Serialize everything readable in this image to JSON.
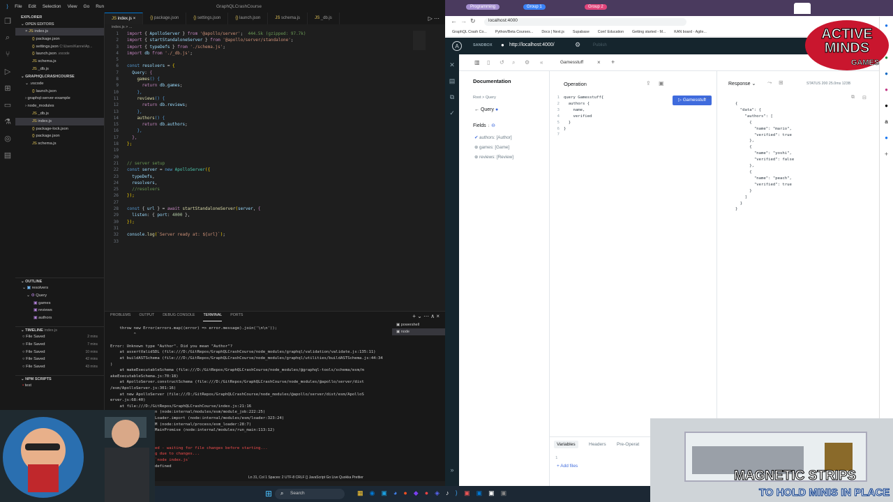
{
  "vscode": {
    "menu": [
      "File",
      "Edit",
      "Selection",
      "View",
      "Go",
      "Run"
    ],
    "title": "GraphQLCrashCourse",
    "explorer_label": "EXPLORER",
    "open_editors_label": "OPEN EDITORS",
    "open_editors": [
      "index.js",
      "package.json",
      "settings.json",
      "launch.json",
      "schema.js",
      "_db.js"
    ],
    "launch_hint": "C:\\Users\\Kanne\\Ap...",
    "launch_vscode": ".vscode",
    "project_label": "GRAPHQLCRASHCOURSE",
    "tree": [
      ".vscode",
      "launch.json",
      "graphql-server-example",
      "node_modules",
      "_db.js",
      "index.js",
      "package-lock.json",
      "package.json",
      "schema.js"
    ],
    "outline_label": "OUTLINE",
    "outline": [
      "resolvers",
      "Query",
      "games",
      "reviews",
      "authors"
    ],
    "timeline_label": "TIMELINE",
    "timeline_file": "index.js",
    "timeline": [
      [
        "File Saved",
        "2 mins"
      ],
      [
        "File Saved",
        "7 mins"
      ],
      [
        "File Saved",
        "10 mins"
      ],
      [
        "File Saved",
        "42 mins"
      ],
      [
        "File Saved",
        "43 mins"
      ]
    ],
    "npm_label": "NPM SCRIPTS",
    "npm_item": "test",
    "tabs": [
      "index.js",
      "package.json",
      "settings.json",
      "launch.json",
      "schema.js",
      "_db.js"
    ],
    "breadcrumb": "index.js > ...",
    "code_lines": [
      "import { ApolloServer } from '@apollo/server';  444.5k (gzipped: 97.7k)",
      "import { startStandaloneServer } from '@apollo/server/standalone';",
      "import { typeDefs } from './schema.js';",
      "import db from './_db.js';",
      "",
      "const resolvers = {",
      "  Query: {",
      "    games() {",
      "      return db.games;",
      "    },",
      "    reviews() {",
      "      return db.reviews;",
      "    },",
      "    authors() {",
      "      return db.authors;",
      "    },",
      "  },",
      "};",
      "",
      "",
      "// server setup",
      "const server = new ApolloServer({",
      "  typeDefs,",
      "  resolvers,",
      "  //resolvers",
      "});",
      "",
      "const { url } = await startStandaloneServer(server, {",
      "  listen: { port: 4000 },",
      "});",
      "",
      "console.log(`Server ready at: ${url}`);",
      ""
    ],
    "panel_tabs": [
      "PROBLEMS",
      "OUTPUT",
      "DEBUG CONSOLE",
      "TERMINAL",
      "PORTS"
    ],
    "terminals": [
      "powershell",
      "node"
    ],
    "terminal_lines": [
      "    throw new Error(errors.map((error) => error.message).join('\\n\\n'));",
      "          ^",
      "",
      "Error: Unknown type \"Author\". Did you mean \"Author\"?",
      "    at assertValidSDL (file:///D:/GitRepos/GraphQLCrashCourse/node_modules/graphql/validation/validate.js:135:11)",
      "    at buildASTSchema (file:///D:/GitRepos/GraphQLCrashCourse/node_modules/graphql/utilities/buildASTSchema.js:44:34",
      ")",
      "    at makeExecutableSchema (file:///D:/GitRepos/GraphQLCrashCourse/node_modules/@graphql-tools/schema/esm/m",
      "akeExecutableSchema.js:70:18)",
      "    at ApolloServer.constructSchema (file:///D:/GitRepos/GraphQLCrashCourse/node_modules/@apollo/server/dist",
      "/esm/ApolloServer.js:301:16)",
      "    at new ApolloServer (file:///D:/GitRepos/GraphQLCrashCourse/node_modules/@apollo/server/dist/esm/ApolloS",
      "erver.js:68:40)",
      "    at file:///D:/GitRepos/GraphQLCrashCourse/index.js:21:16",
      "    at ModuleJob.run (node:internal/modules/esm/module_job:222:25)",
      "    at async ModuleLoader.import (node:internal/modules/esm/loader:323:24)",
      "    at async loadESM (node:internal/process/esm_loader:28:7)",
      "    at async handleMainPromise (node:internal/modules/run_main:113:12)",
      "",
      "Node.js v20.12.2",
      "[nodemon] app crashed - waiting for file changes before starting...",
      "[nodemon] restarting due to changes...",
      "[nodemon] starting `node index.js`",
      "Server ready at: undefined"
    ],
    "status": "Ln 31, Col 1   Spaces: 2   UTF-8   CRLF   {} JavaScript   Go Live   Quokka   Prettier"
  },
  "browser": {
    "tab_group1": "Programming",
    "tab_group2": "Group 1",
    "tab_group3": "Group 2",
    "address": "localhost:4000",
    "bookmarks": [
      "GraphQL Crash Co...",
      "Python/Beta Courses...",
      "Docs | Next.js",
      "Supabase",
      "Cont' Education",
      "Getting started - M...",
      "KAN board - Agile..."
    ],
    "sandbox_label": "SANDBOX",
    "sandbox_url": "http://localhost:4000/",
    "publish": "Publish",
    "op_tab": "Gamesstuff",
    "doc_title": "Documentation",
    "root_crumb": "Root > Query",
    "query_label": "Query",
    "fields_label": "Fields",
    "fields": [
      "authors: [Author]",
      "games: [Game]",
      "reviews: [Review]"
    ],
    "operation_title": "Operation",
    "run_label": "Gamesstuff",
    "operation_code": [
      "query Gamesstuff{",
      "  authors {",
      "    name,",
      "    verified",
      "  }",
      "}",
      ""
    ],
    "response_label": "Response",
    "status": "STATUS 200   25.0ms   123B",
    "response_lines": [
      "{",
      "  \"data\": {",
      "    \"authors\": [",
      "      {",
      "        \"name\": \"mario\",",
      "        \"verified\": true",
      "      },",
      "      {",
      "        \"name\": \"yoshi\",",
      "        \"verified\": false",
      "      },",
      "      {",
      "        \"name\": \"peach\",",
      "        \"verified\": true",
      "      }",
      "    ]",
      "  }",
      "}"
    ],
    "var_tabs": [
      "Variables",
      "Headers",
      "Pre-Operat"
    ],
    "var_line": "1",
    "add_files": "Add files"
  },
  "overlay": {
    "logo_line1": "ACTIVE",
    "logo_line2": "MINDS",
    "logo_line3": "GAMES",
    "promo1": "MAGNETIC STRIPS",
    "promo2": "TO HOLD MINIS IN PLACE"
  },
  "taskbar": {
    "search": "Search"
  },
  "icons": {
    "search": "search-icon",
    "play": "play-icon",
    "settings": "gear-icon"
  }
}
